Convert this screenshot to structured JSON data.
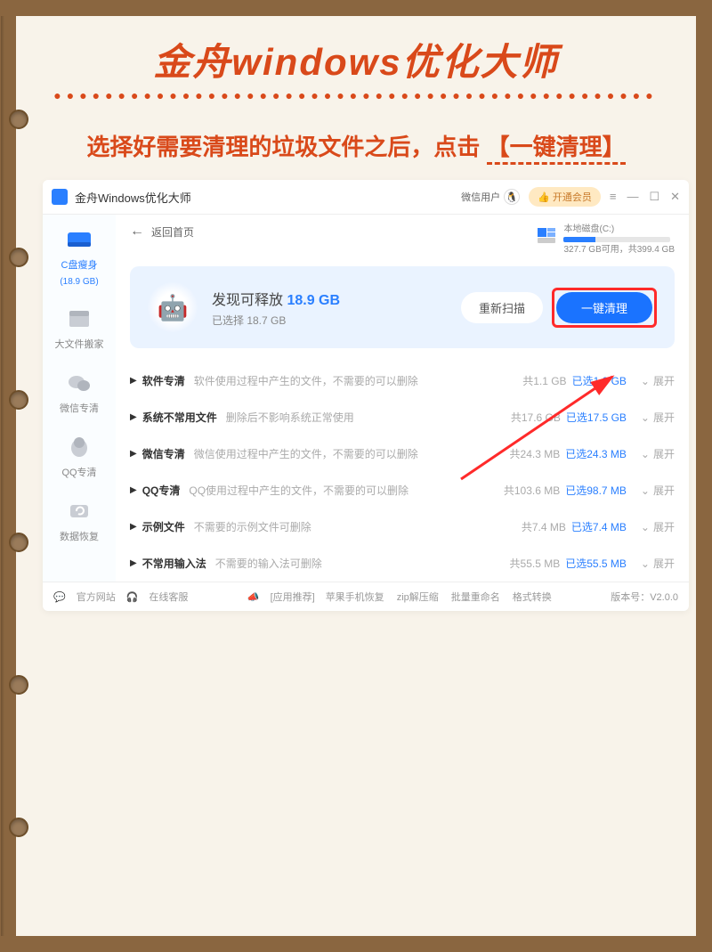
{
  "poster": {
    "title": "金舟windows优化大师",
    "subtitle_pre": "选择好需要清理的垃圾文件之后，点击",
    "subtitle_key": "【一键清理】"
  },
  "titlebar": {
    "app_name": "金舟Windows优化大师",
    "wechat_user": "微信用户",
    "vip_button": "👍 开通会员"
  },
  "sidebar": {
    "items": [
      {
        "label": "C盘瘦身",
        "sub": "(18.9 GB)"
      },
      {
        "label": "大文件搬家"
      },
      {
        "label": "微信专清"
      },
      {
        "label": "QQ专清"
      },
      {
        "label": "数据恢复"
      }
    ]
  },
  "header": {
    "back_label": "返回首页",
    "disk_name": "本地磁盘(C:)",
    "disk_usage": "327.7 GB可用，共399.4 GB"
  },
  "summary": {
    "prefix": "发现可释放 ",
    "amount": "18.9 GB",
    "selected": "已选择 18.7 GB",
    "rescan": "重新扫描",
    "clean": "一键清理"
  },
  "groups": [
    {
      "name": "软件专清",
      "desc": "软件使用过程中产生的文件，不需要的可以删除",
      "total": "共1.1 GB",
      "selected": "已选1.0 GB",
      "expand": "展开"
    },
    {
      "name": "系统不常用文件",
      "desc": "删除后不影响系统正常使用",
      "total": "共17.6 GB",
      "selected": "已选17.5 GB",
      "expand": "展开"
    },
    {
      "name": "微信专清",
      "desc": "微信使用过程中产生的文件，不需要的可以删除",
      "total": "共24.3 MB",
      "selected": "已选24.3 MB",
      "expand": "展开"
    },
    {
      "name": "QQ专清",
      "desc": "QQ使用过程中产生的文件，不需要的可以删除",
      "total": "共103.6 MB",
      "selected": "已选98.7 MB",
      "expand": "展开"
    },
    {
      "name": "示例文件",
      "desc": "不需要的示例文件可删除",
      "total": "共7.4 MB",
      "selected": "已选7.4 MB",
      "expand": "展开"
    },
    {
      "name": "不常用输入法",
      "desc": "不需要的输入法可删除",
      "total": "共55.5 MB",
      "selected": "已选55.5 MB",
      "expand": "展开"
    }
  ],
  "footer": {
    "official": "官方网站",
    "support": "在线客服",
    "recommend": "[应用推荐]",
    "links": [
      "苹果手机恢复",
      "zip解压缩",
      "批量重命名",
      "格式转换"
    ],
    "version": "版本号：V2.0.0"
  }
}
